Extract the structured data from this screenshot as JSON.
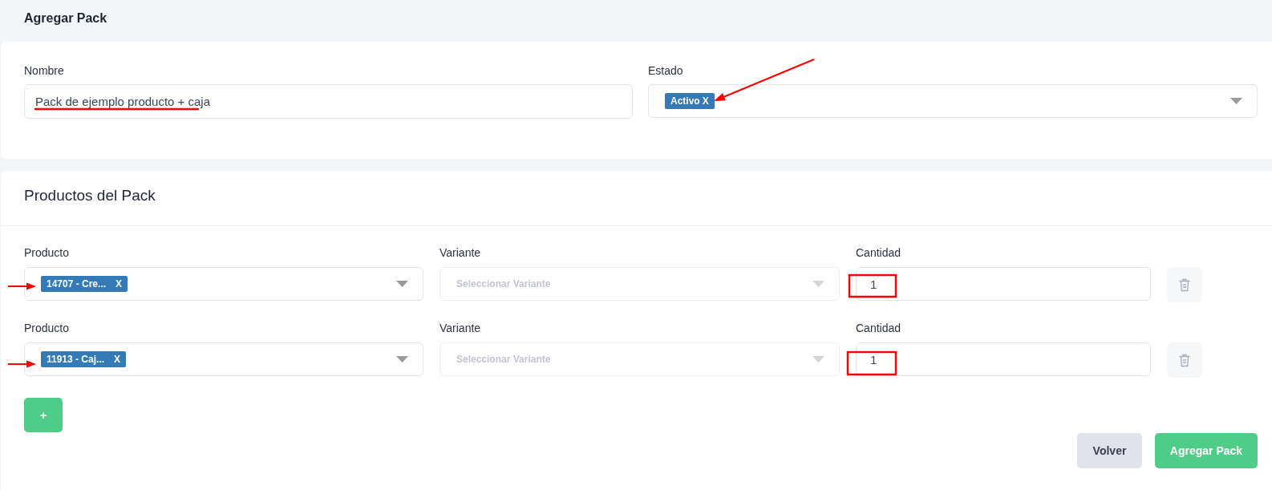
{
  "page_title": "Agregar Pack",
  "general": {
    "fields": [
      {
        "kind": "text",
        "label": "Nombre",
        "value": "Pack de ejemplo producto + caja"
      },
      {
        "kind": "select",
        "label": "Estado",
        "chip": {
          "label": "Activo",
          "remove": "X"
        }
      }
    ]
  },
  "products": {
    "title": "Productos del Pack",
    "rows": [
      {
        "product": {
          "label": "Producto",
          "chip": {
            "label": "14707 - Cre...",
            "remove": "X"
          }
        },
        "variant": {
          "label": "Variante",
          "placeholder": "Seleccionar Variante",
          "disabled": true
        },
        "quantity": {
          "label": "Cantidad",
          "value": "1"
        }
      },
      {
        "product": {
          "label": "Producto",
          "chip": {
            "label": "11913 - Caj...",
            "remove": "X"
          }
        },
        "variant": {
          "label": "Variante",
          "placeholder": "Seleccionar Variante",
          "disabled": true
        },
        "quantity": {
          "label": "Cantidad",
          "value": "1"
        }
      }
    ],
    "add_button": "+"
  },
  "buttons": [
    {
      "kind": "secondary",
      "label": "Volver"
    },
    {
      "kind": "primary",
      "label": "Agregar Pack"
    }
  ]
}
